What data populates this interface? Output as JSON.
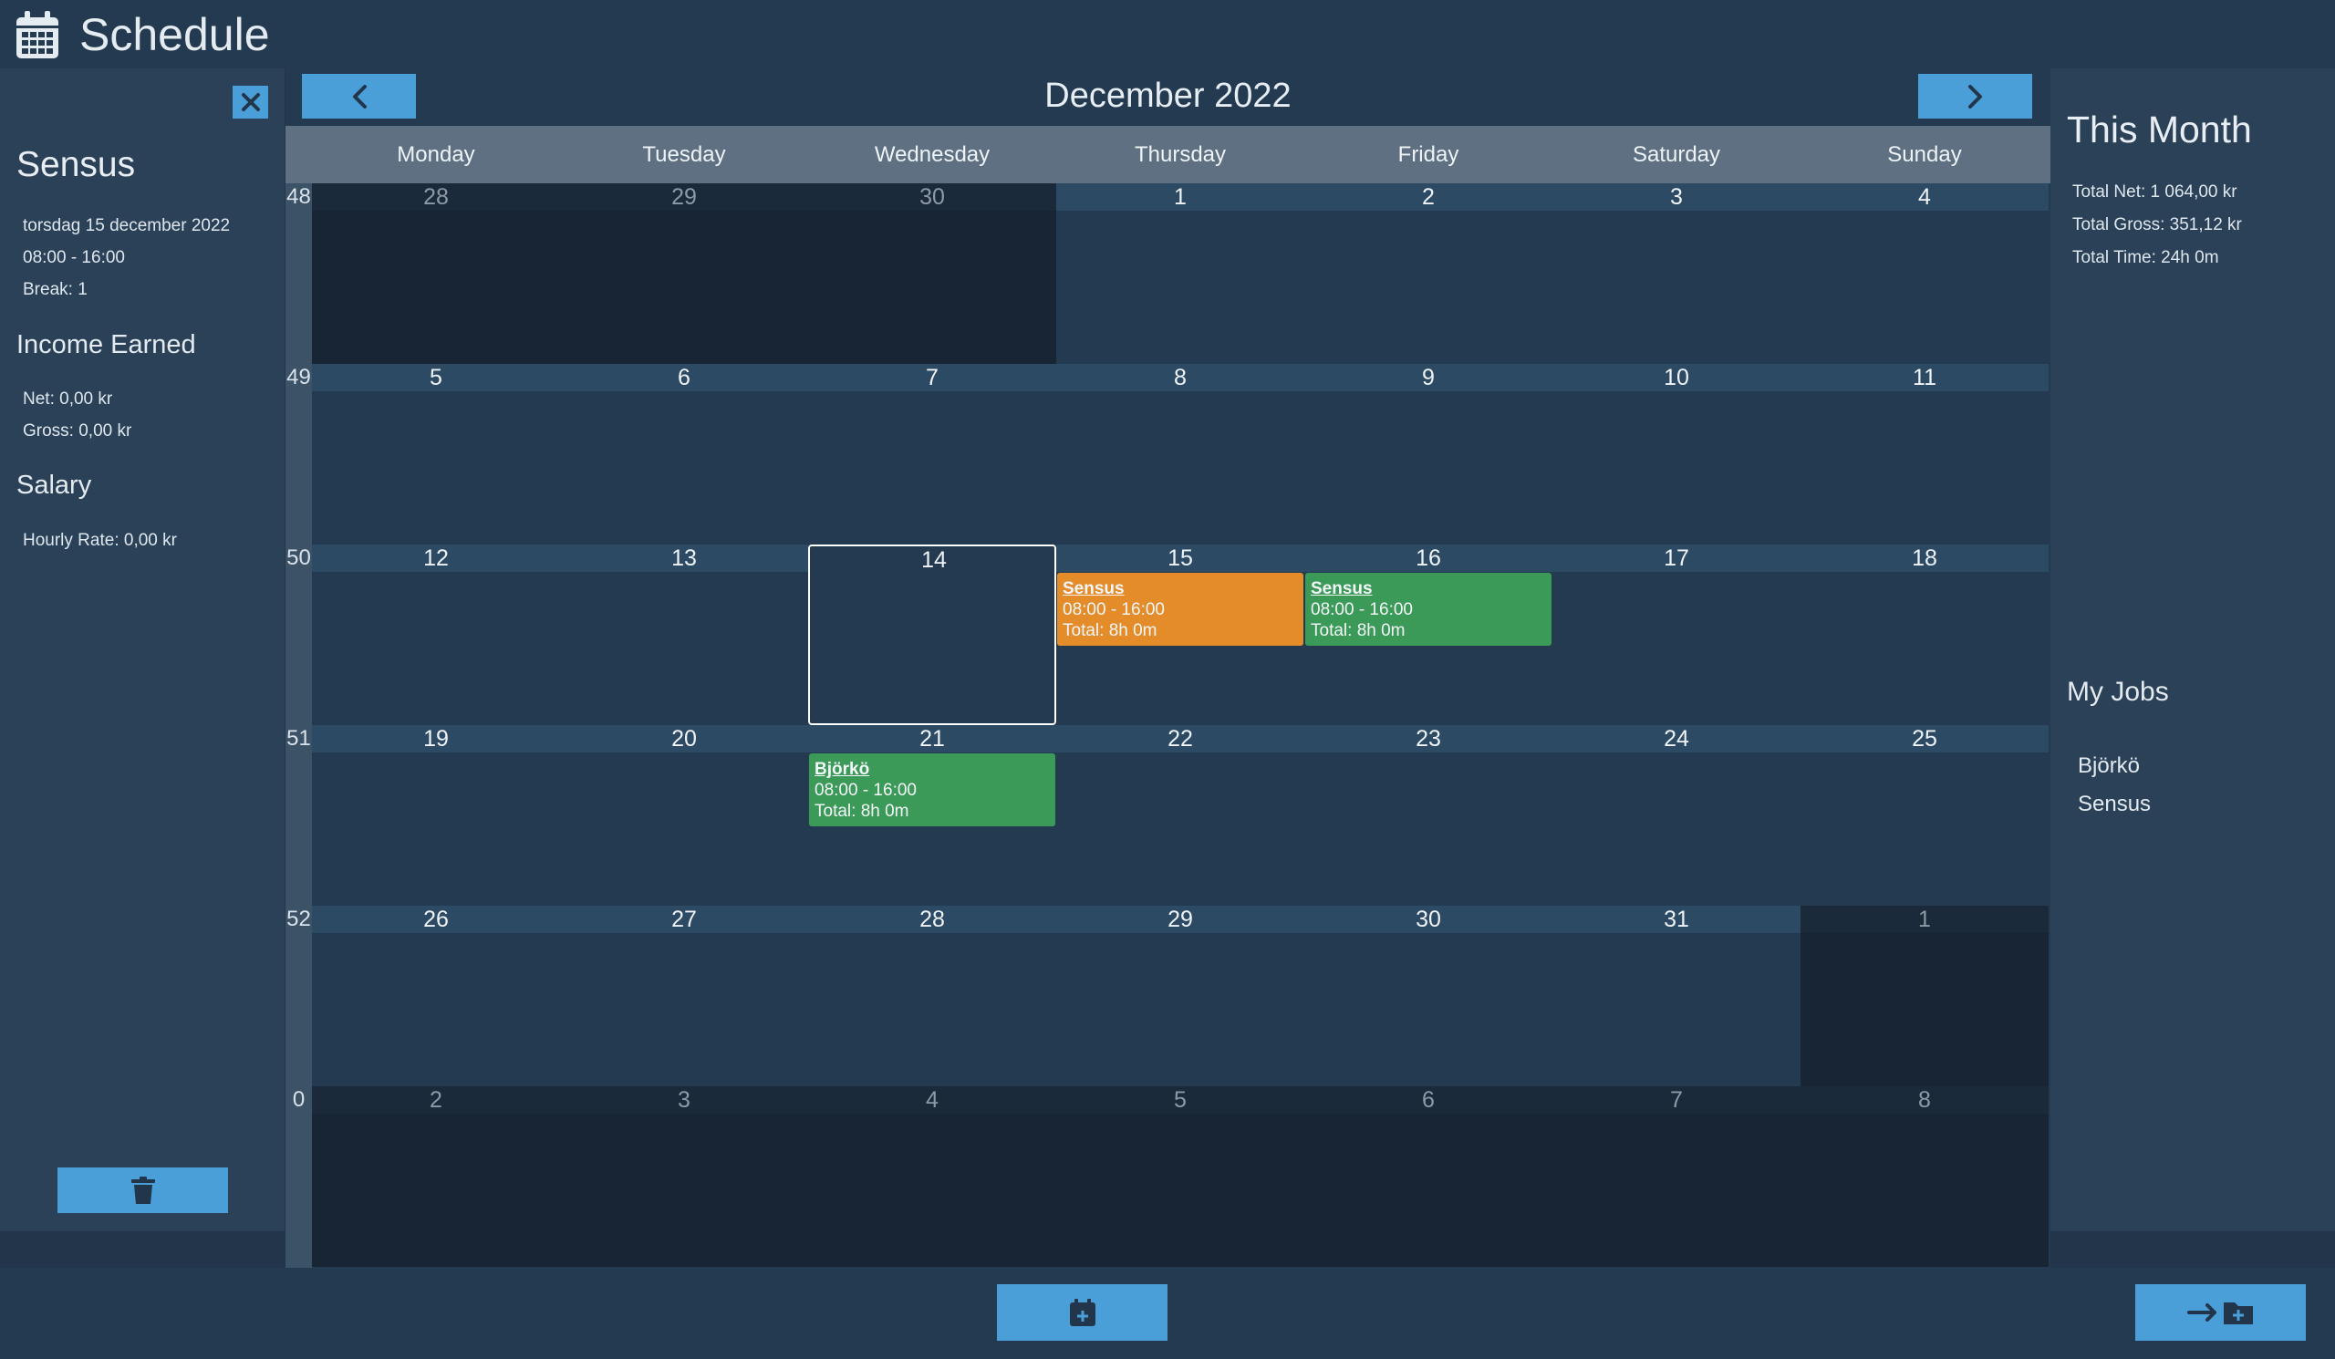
{
  "app": {
    "title": "Schedule"
  },
  "left_panel": {
    "job_title": "Sensus",
    "date_text": "torsdag 15 december 2022",
    "time_text": "08:00 - 16:00",
    "break_text": "Break: 1",
    "income_heading": "Income Earned",
    "net_text": "Net: 0,00 kr",
    "gross_text": "Gross: 0,00 kr",
    "salary_heading": "Salary",
    "hourly_rate_text": "Hourly Rate: 0,00 kr"
  },
  "calendar": {
    "month_title": "December 2022",
    "weekdays": [
      "Monday",
      "Tuesday",
      "Wednesday",
      "Thursday",
      "Friday",
      "Saturday",
      "Sunday"
    ],
    "weeks": [
      {
        "week": "48",
        "days": [
          {
            "d": "28",
            "other": true
          },
          {
            "d": "29",
            "other": true
          },
          {
            "d": "30",
            "other": true
          },
          {
            "d": "1"
          },
          {
            "d": "2"
          },
          {
            "d": "3"
          },
          {
            "d": "4"
          }
        ]
      },
      {
        "week": "49",
        "days": [
          {
            "d": "5"
          },
          {
            "d": "6"
          },
          {
            "d": "7"
          },
          {
            "d": "8"
          },
          {
            "d": "9"
          },
          {
            "d": "10"
          },
          {
            "d": "11"
          }
        ]
      },
      {
        "week": "50",
        "days": [
          {
            "d": "12"
          },
          {
            "d": "13"
          },
          {
            "d": "14",
            "today": true
          },
          {
            "d": "15",
            "event": {
              "title": "Sensus",
              "time": "08:00 - 16:00",
              "total": "Total: 8h 0m",
              "color": "orange"
            }
          },
          {
            "d": "16",
            "event": {
              "title": "Sensus",
              "time": "08:00 - 16:00",
              "total": "Total: 8h 0m",
              "color": "green"
            }
          },
          {
            "d": "17"
          },
          {
            "d": "18"
          }
        ]
      },
      {
        "week": "51",
        "days": [
          {
            "d": "19"
          },
          {
            "d": "20"
          },
          {
            "d": "21",
            "event": {
              "title": "Björkö",
              "time": "08:00 - 16:00",
              "total": "Total: 8h 0m",
              "color": "green"
            }
          },
          {
            "d": "22"
          },
          {
            "d": "23"
          },
          {
            "d": "24"
          },
          {
            "d": "25"
          }
        ]
      },
      {
        "week": "52",
        "days": [
          {
            "d": "26"
          },
          {
            "d": "27"
          },
          {
            "d": "28"
          },
          {
            "d": "29"
          },
          {
            "d": "30"
          },
          {
            "d": "31"
          },
          {
            "d": "1",
            "other": true
          }
        ]
      },
      {
        "week": "0",
        "days": [
          {
            "d": "2",
            "other": true
          },
          {
            "d": "3",
            "other": true
          },
          {
            "d": "4",
            "other": true
          },
          {
            "d": "5",
            "other": true
          },
          {
            "d": "6",
            "other": true
          },
          {
            "d": "7",
            "other": true
          },
          {
            "d": "8",
            "other": true
          }
        ]
      }
    ]
  },
  "right_panel": {
    "title": "This Month",
    "total_net": "Total Net: 1 064,00 kr",
    "total_gross": "Total Gross: 351,12 kr",
    "total_time": "Total Time: 24h 0m",
    "jobs_heading": "My Jobs",
    "jobs": [
      "Björkö",
      "Sensus"
    ]
  },
  "icons": {
    "app": "calendar-icon",
    "close": "close-icon",
    "delete": "trash-icon",
    "prev": "chevron-left-icon",
    "next": "chevron-right-icon",
    "add_shift": "calendar-plus-icon",
    "import": "arrow-folder-plus-icon"
  },
  "colors": {
    "accent": "#4a9fd8",
    "event_orange": "#e58c2a",
    "event_green": "#3b9a58"
  }
}
